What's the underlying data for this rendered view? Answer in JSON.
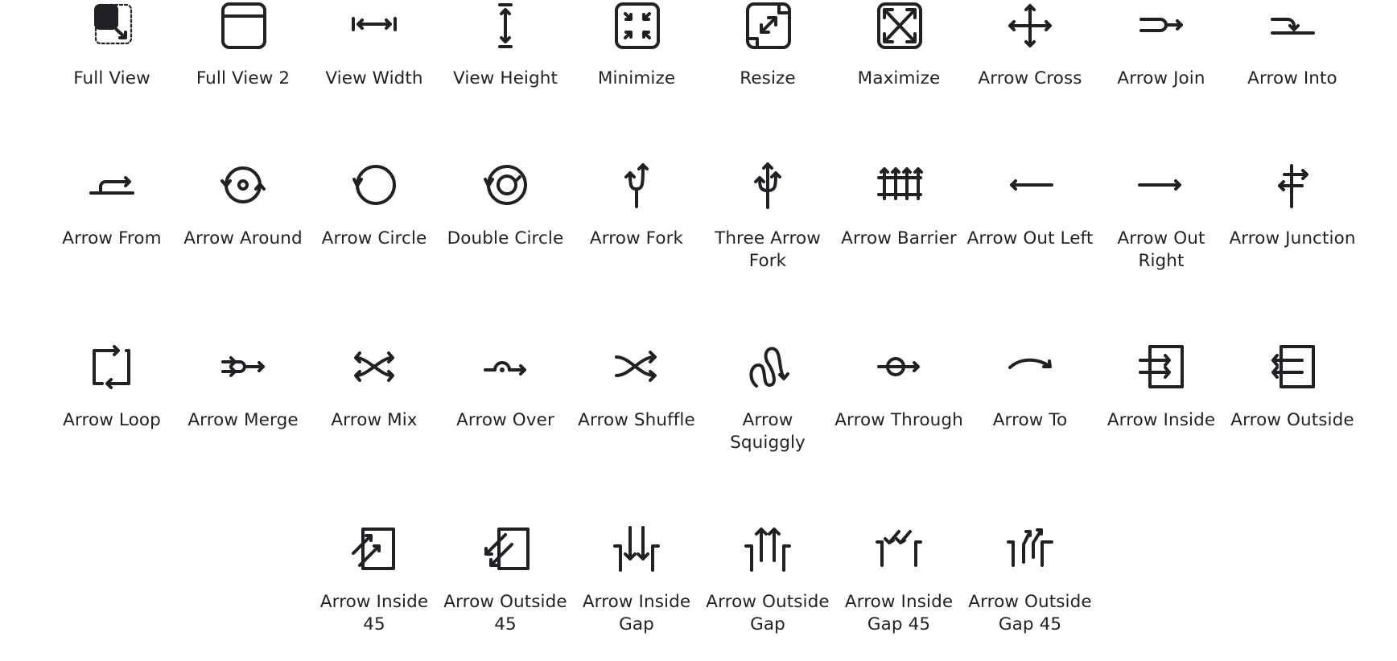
{
  "icons": [
    {
      "label": "Full View",
      "icon": "full-view-icon"
    },
    {
      "label": "Full View 2",
      "icon": "full-view-2-icon"
    },
    {
      "label": "View Width",
      "icon": "view-width-icon"
    },
    {
      "label": "View Height",
      "icon": "view-height-icon"
    },
    {
      "label": "Minimize",
      "icon": "minimize-icon"
    },
    {
      "label": "Resize",
      "icon": "resize-icon"
    },
    {
      "label": "Maximize",
      "icon": "maximize-icon"
    },
    {
      "label": "Arrow Cross",
      "icon": "arrow-cross-icon"
    },
    {
      "label": "Arrow Join",
      "icon": "arrow-join-icon"
    },
    {
      "label": "Arrow Into",
      "icon": "arrow-into-icon"
    },
    {
      "label": "Arrow From",
      "icon": "arrow-from-icon"
    },
    {
      "label": "Arrow Around",
      "icon": "arrow-around-icon"
    },
    {
      "label": "Arrow Circle",
      "icon": "arrow-circle-icon"
    },
    {
      "label": "Double Circle",
      "icon": "double-circle-icon"
    },
    {
      "label": "Arrow Fork",
      "icon": "arrow-fork-icon"
    },
    {
      "label": "Three Arrow Fork",
      "icon": "three-arrow-fork-icon"
    },
    {
      "label": "Arrow Barrier",
      "icon": "arrow-barrier-icon"
    },
    {
      "label": "Arrow Out Left",
      "icon": "arrow-out-left-icon"
    },
    {
      "label": "Arrow Out Right",
      "icon": "arrow-out-right-icon"
    },
    {
      "label": "Arrow Junction",
      "icon": "arrow-junction-icon"
    },
    {
      "label": "Arrow Loop",
      "icon": "arrow-loop-icon"
    },
    {
      "label": "Arrow Merge",
      "icon": "arrow-merge-icon"
    },
    {
      "label": "Arrow Mix",
      "icon": "arrow-mix-icon"
    },
    {
      "label": "Arrow Over",
      "icon": "arrow-over-icon"
    },
    {
      "label": "Arrow Shuffle",
      "icon": "arrow-shuffle-icon"
    },
    {
      "label": "Arrow Squiggly",
      "icon": "arrow-squiggly-icon"
    },
    {
      "label": "Arrow Through",
      "icon": "arrow-through-icon"
    },
    {
      "label": "Arrow To",
      "icon": "arrow-to-icon"
    },
    {
      "label": "Arrow Inside",
      "icon": "arrow-inside-icon"
    },
    {
      "label": "Arrow Outside",
      "icon": "arrow-outside-icon"
    },
    {
      "label": "Arrow Inside 45",
      "icon": "arrow-inside-45-icon"
    },
    {
      "label": "Arrow Outside 45",
      "icon": "arrow-outside-45-icon"
    },
    {
      "label": "Arrow Inside Gap",
      "icon": "arrow-inside-gap-icon"
    },
    {
      "label": "Arrow Outside Gap",
      "icon": "arrow-outside-gap-icon"
    },
    {
      "label": "Arrow Inside Gap 45",
      "icon": "arrow-inside-gap-45-icon"
    },
    {
      "label": "Arrow Outside Gap 45",
      "icon": "arrow-outside-gap-45-icon"
    }
  ],
  "colors": {
    "icon": "#1f2125",
    "text": "#1f2125",
    "background": "#ffffff"
  }
}
